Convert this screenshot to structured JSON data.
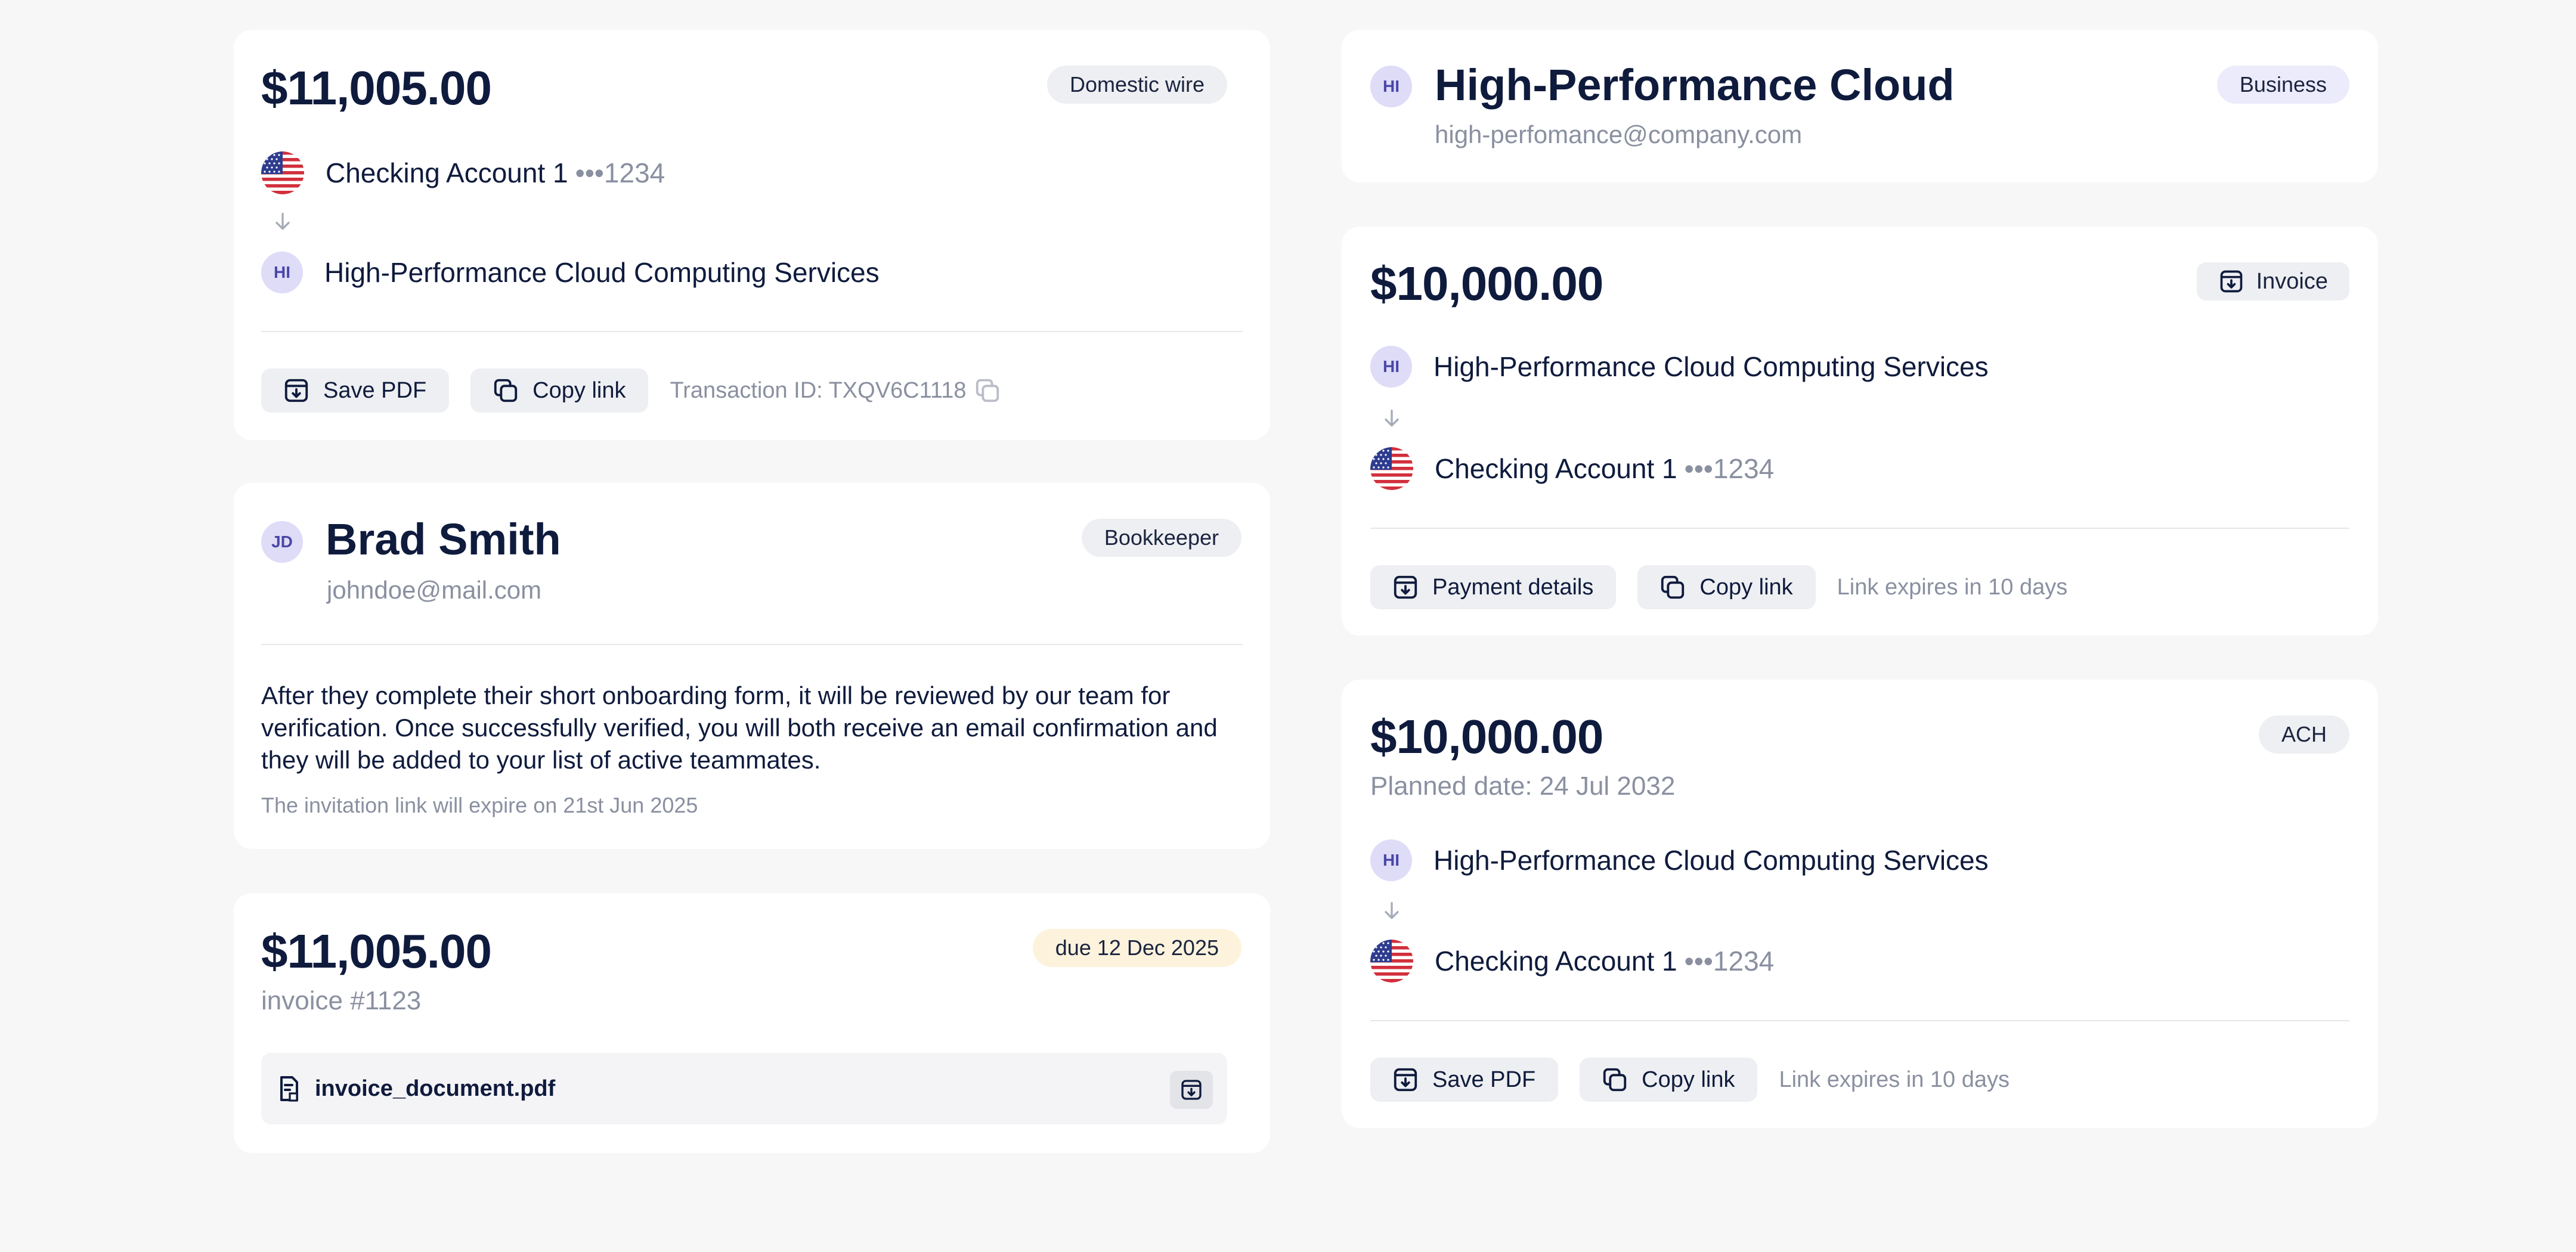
{
  "card_wire": {
    "amount": "$11,005.00",
    "badge": "Domestic wire",
    "from": {
      "name": "Checking Account 1",
      "mask": "•••1234",
      "icon": "us-flag-icon"
    },
    "to": {
      "initials": "HI",
      "name": "High-Performance Cloud Computing Services"
    },
    "actions": {
      "save_pdf": "Save PDF",
      "copy_link": "Copy link"
    },
    "transaction_id": "Transaction ID: TXQV6C1118"
  },
  "card_member": {
    "initials": "JD",
    "name": "Brad Smith",
    "email": "johndoe@mail.com",
    "role_badge": "Bookkeeper",
    "message": "After they complete their short onboarding form, it will be reviewed by our team for verification. Once successfully verified, you will both receive an email confirmation and they will be added to your list of active teammates.",
    "expiry_note": "The invitation link will expire on 21st Jun 2025"
  },
  "card_invoice": {
    "amount": "$11,005.00",
    "due_badge": "due 12 Dec 2025",
    "invoice_number": "invoice #1123",
    "file_name": "invoice_document.pdf"
  },
  "card_contact": {
    "initials": "HI",
    "name": "High-Performance Cloud",
    "email": "high-perfomance@company.com",
    "badge": "Business"
  },
  "card_payment_request": {
    "amount": "$10,000.00",
    "invoice_button": "Invoice",
    "from": {
      "initials": "HI",
      "name": "High-Performance Cloud Computing Services"
    },
    "to": {
      "name": "Checking Account 1",
      "mask": "•••1234"
    },
    "actions": {
      "payment_details": "Payment details",
      "copy_link": "Copy link"
    },
    "expiry": "Link expires in 10 days"
  },
  "card_ach": {
    "amount": "$10,000.00",
    "planned_date": "Planned date: 24 Jul 2032",
    "badge": "ACH",
    "from": {
      "initials": "HI",
      "name": "High-Performance Cloud Computing Services"
    },
    "to": {
      "name": "Checking Account 1",
      "mask": "•••1234"
    },
    "actions": {
      "save_pdf": "Save PDF",
      "copy_link": "Copy link"
    },
    "expiry": "Link expires in 10 days"
  },
  "colors": {
    "background": "#f7f7f8",
    "text_primary": "#0f1b3d",
    "text_muted": "#8a90a0",
    "avatar_bg": "#dedcf7",
    "badge_grey": "#eeeff2",
    "badge_lavender": "#ecebfb",
    "badge_cream": "#fdf3dc"
  }
}
